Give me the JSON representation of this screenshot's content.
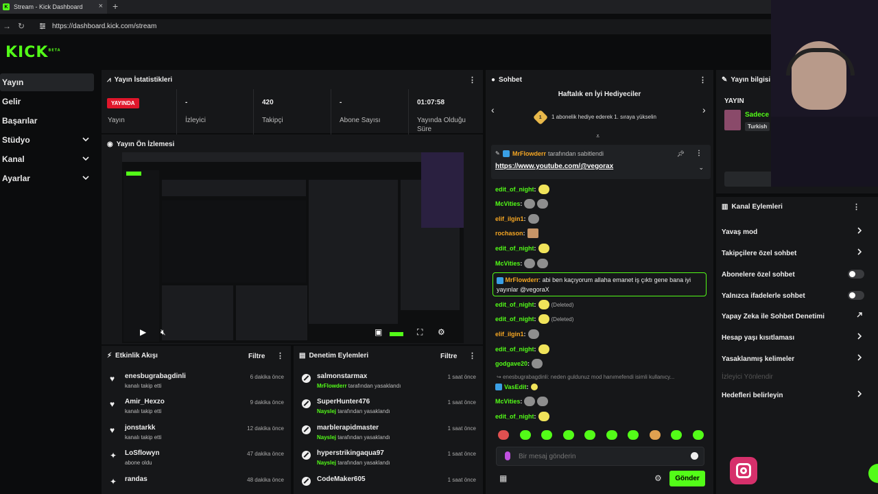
{
  "browser": {
    "tab_title": "Stream - Kick Dashboard",
    "tab_close": "×",
    "new_tab": "+",
    "url": "https://dashboard.kick.com/stream"
  },
  "logo": {
    "text": "KICK",
    "beta": "BETA"
  },
  "sidebar": {
    "items": [
      {
        "label": "Yayın",
        "active": true
      },
      {
        "label": "Gelir"
      },
      {
        "label": "Başarılar"
      },
      {
        "label": "Stüdyo",
        "expandable": true
      },
      {
        "label": "Kanal",
        "expandable": true
      },
      {
        "label": "Ayarlar",
        "expandable": true
      }
    ]
  },
  "stats": {
    "title": "Yayın İstatistikleri",
    "badge": "YAYINDA",
    "cells": [
      {
        "value": "",
        "label": "Yayın"
      },
      {
        "value": "-",
        "label": "İzleyici"
      },
      {
        "value": "420",
        "label": "Takipçi"
      },
      {
        "value": "-",
        "label": "Abone Sayısı"
      },
      {
        "value": "01:07:58",
        "label": "Yayında Olduğu Süre"
      }
    ]
  },
  "preview": {
    "title": "Yayın Ön İzlemesi"
  },
  "activity": {
    "title": "Etkinlik Akışı",
    "filter": "Filtre",
    "items": [
      {
        "name": "enesbugrabagdinli",
        "sub": "kanalı takip etti",
        "time": "6 dakika önce",
        "icon": "♥"
      },
      {
        "name": "Amir_Hexzo",
        "sub": "kanalı takip etti",
        "time": "9 dakika önce",
        "icon": "♥"
      },
      {
        "name": "jonstarkk",
        "sub": "kanalı takip etti",
        "time": "12 dakika önce",
        "icon": "♥"
      },
      {
        "name": "LoSflowyn",
        "sub": "abone oldu",
        "time": "47 dakika önce",
        "icon": "✦"
      },
      {
        "name": "randas",
        "sub": "",
        "time": "48 dakika önce",
        "icon": "✦"
      }
    ]
  },
  "moderation": {
    "title": "Denetim Eylemleri",
    "filter": "Filtre",
    "items": [
      {
        "name": "salmonstarmax",
        "by": "MrFlowderr",
        "action": "tarafından yasaklandı",
        "time": "1 saat önce"
      },
      {
        "name": "SuperHunter476",
        "by": "Nayslej",
        "action": "tarafından yasaklandı",
        "time": "1 saat önce"
      },
      {
        "name": "marblerapidmaster",
        "by": "Nayslej",
        "action": "tarafından yasaklandı",
        "time": "1 saat önce"
      },
      {
        "name": "hyperstrikingaqua97",
        "by": "Nayslej",
        "action": "tarafından yasaklandı",
        "time": "1 saat önce"
      },
      {
        "name": "CodeMaker605",
        "by": "",
        "action": "",
        "time": "1 saat önce"
      }
    ]
  },
  "chat": {
    "title": "Sohbet",
    "gifters_title": "Haftalık en İyi Hediyeciler",
    "gifters_rank": "1",
    "gifters_text": "1 abonelik hediye ederek 1. sıraya yükselin",
    "pinned_by": "MrFlowderr",
    "pinned_suffix": "tarafından sabitlendi",
    "pinned_link": "https://www.youtube.com/@vegorax",
    "highlight_user": "MrFlowderr",
    "highlight_text": "abi ben kaçıyorum allaha emanet iş çıktı gene bana iyi yayınlar @vegoraX",
    "reply_preview": "enesbugrabagdinli: neden guldunuz mod hanımefendi isimli kullanıcy...",
    "deleted_label": "(Deleted)",
    "lines": [
      {
        "user": "edit_of_night",
        "color": "#53fc18"
      },
      {
        "user": "McVities",
        "color": "#53fc18"
      },
      {
        "user": "elif_ilgin1",
        "color": "#f5a623"
      },
      {
        "user": "rochason",
        "color": "#f5a623"
      },
      {
        "user": "edit_of_night",
        "color": "#53fc18"
      },
      {
        "user": "McVities",
        "color": "#53fc18"
      }
    ],
    "lines2": [
      {
        "user": "edit_of_night",
        "color": "#53fc18"
      },
      {
        "user": "edit_of_night",
        "color": "#53fc18"
      },
      {
        "user": "elif_ilgin1",
        "color": "#f5a623"
      },
      {
        "user": "edit_of_night",
        "color": "#53fc18"
      },
      {
        "user": "godgave20",
        "color": "#53fc18"
      }
    ],
    "lines3": [
      {
        "user": "VasEdit",
        "color": "#53fc18"
      },
      {
        "user": "McVities",
        "color": "#53fc18"
      },
      {
        "user": "edit_of_night",
        "color": "#53fc18"
      }
    ],
    "input_placeholder": "Bir mesaj gönderin",
    "send_label": "Gönder"
  },
  "stream_info": {
    "title": "Yayın bilgisi",
    "status": "YAYIN",
    "category_name": "Sadece",
    "tag": "Turkish"
  },
  "channel_actions": {
    "title": "Kanal Eylemleri",
    "items": [
      {
        "label": "Yavaş mod",
        "control": "arrow"
      },
      {
        "label": "Takipçilere özel sohbet",
        "control": "arrow"
      },
      {
        "label": "Abonelere özel sohbet",
        "control": "toggle"
      },
      {
        "label": "Yalnızca ifadelerle sohbet",
        "control": "toggle"
      },
      {
        "label": "Yapay Zeka ile Sohbet Denetimi",
        "control": "external"
      },
      {
        "label": "Hesap yaşı kısıtlaması",
        "control": "arrow"
      },
      {
        "label": "Yasaklanmış kelimeler",
        "control": "arrow"
      },
      {
        "label": "İzleyici Yönlendir",
        "control": "none",
        "disabled": true
      },
      {
        "label": "Hedefleri belirleyin",
        "control": "arrow"
      }
    ]
  },
  "colors": {
    "accent": "#53fc18",
    "live": "#e0162b",
    "panel": "#161719"
  }
}
